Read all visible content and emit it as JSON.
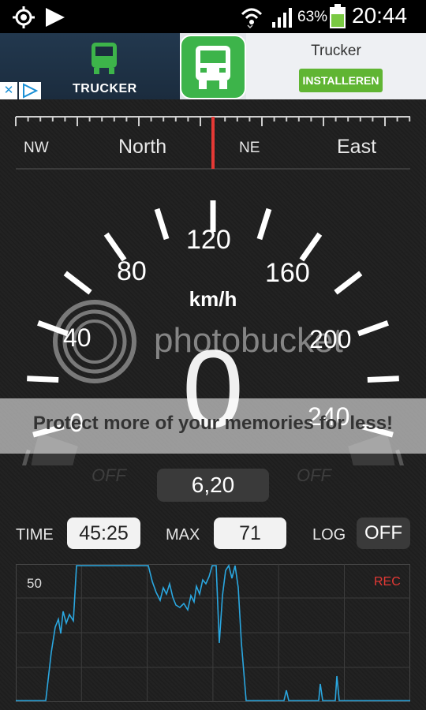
{
  "status_bar": {
    "battery": "63%",
    "time": "20:44",
    "icons": [
      "crosshair-gps-icon",
      "play-icon",
      "wifi-icon",
      "signal-icon",
      "battery-icon"
    ]
  },
  "ad": {
    "brand": "TRUCKER",
    "title": "Trucker",
    "install_label": "INSTALLEREN",
    "close_glyph": "✕"
  },
  "compass": {
    "labels": [
      "NW",
      "North",
      "NE",
      "East"
    ]
  },
  "speedometer": {
    "scale": [
      "0",
      "40",
      "80",
      "120",
      "160",
      "200",
      "240"
    ],
    "unit": "km/h",
    "speed": "0",
    "left_status": "OFF",
    "right_status": "OFF",
    "trip_value": "6,20"
  },
  "controls": {
    "time_label": "TIME",
    "time_value": "45:25",
    "max_label": "MAX",
    "max_value": "71",
    "log_label": "LOG",
    "log_value": "OFF"
  },
  "graph": {
    "y_label": "50",
    "rec_label": "REC"
  },
  "watermark": {
    "logo": "photobucket",
    "tagline": "Protect more of your memories for less!"
  },
  "colors": {
    "accent_red": "#e53935",
    "graph_line": "#2aa7e0",
    "ad_green": "#60b533"
  }
}
